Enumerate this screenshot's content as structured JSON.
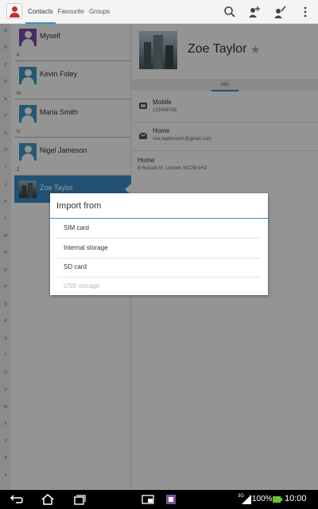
{
  "actionbar": {
    "tabs": [
      "Contacts",
      "Favourite",
      "Groups"
    ],
    "icons": [
      "search-icon",
      "add-contact-icon",
      "edit-contact-icon",
      "overflow-menu-icon"
    ]
  },
  "alphabet": [
    "A",
    "B",
    "C",
    "D",
    "E",
    "F",
    "G",
    "H",
    "I",
    "J",
    "K",
    "L",
    "M",
    "N",
    "O",
    "P",
    "Q",
    "R",
    "S",
    "T",
    "U",
    "V",
    "W",
    "X",
    "Y",
    "Z",
    "#"
  ],
  "contacts": {
    "sections": [
      "K",
      "M",
      "N",
      "Z"
    ],
    "items": [
      {
        "name": "Myself",
        "avatar": "profile-avatar"
      },
      {
        "name": "Kevin Foley",
        "avatar": "generic-avatar"
      },
      {
        "name": "Maria Smith",
        "avatar": "generic-avatar"
      },
      {
        "name": "Nigel Jameson",
        "avatar": "generic-avatar"
      },
      {
        "name": "Zoe Taylor",
        "avatar": "photo-avatar",
        "selected": true
      }
    ]
  },
  "details": {
    "name": "Zoe Taylor",
    "info_tab": "Info",
    "fields": [
      {
        "label": "Mobile",
        "value": "123456789",
        "icon": "phone-icon"
      },
      {
        "label": "Home",
        "value": "zoe.taylorsvem@gmail.com",
        "icon": "email-icon"
      },
      {
        "label": "Home",
        "value": "8 Russell St, London WC2B 5HZ",
        "icon": ""
      }
    ]
  },
  "dialog": {
    "title": "Import from",
    "options": [
      {
        "label": "SIM card",
        "enabled": true
      },
      {
        "label": "Internal storage",
        "enabled": true
      },
      {
        "label": "SD card",
        "enabled": true
      },
      {
        "label": "USB storage",
        "enabled": false
      }
    ]
  },
  "statusbar": {
    "battery": "100%",
    "time": "10:00",
    "network": "3G"
  },
  "colors": {
    "accent": "#3a8ecb",
    "avatar_blue": "#3d99c8",
    "profile_purple": "#7d4fa8"
  }
}
